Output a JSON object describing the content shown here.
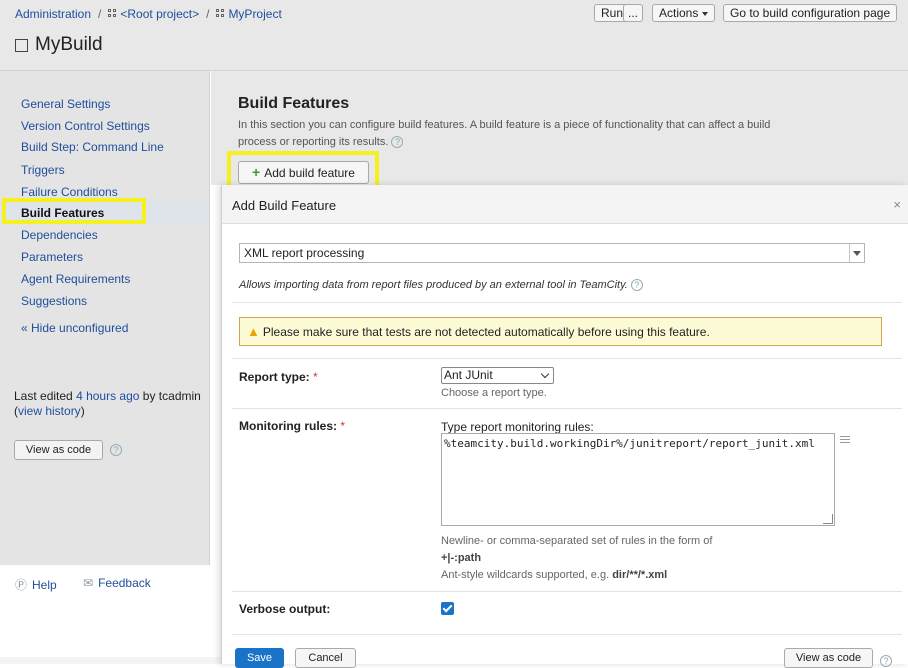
{
  "breadcrumb": {
    "items": [
      "Administration",
      "<Root project>",
      "MyProject"
    ]
  },
  "page_title": "MyBuild",
  "header_buttons": {
    "run": "Run",
    "more": "...",
    "actions": "Actions",
    "go_to_config": "Go to build configuration page"
  },
  "sidebar": {
    "items": [
      {
        "label": "General Settings"
      },
      {
        "label": "Version Control Settings"
      },
      {
        "label": "Build Step: Command Line"
      },
      {
        "label": "Triggers"
      },
      {
        "label": "Failure Conditions"
      },
      {
        "label": "Build Features"
      },
      {
        "label": "Dependencies"
      },
      {
        "label": "Parameters"
      },
      {
        "label": "Agent Requirements"
      },
      {
        "label": "Suggestions"
      }
    ],
    "hide_unconfigured": "« Hide unconfigured",
    "last_edited_prefix": "Last edited",
    "last_edited_time": "4 hours ago",
    "last_edited_by": "by tcadmin",
    "view_history": "view history",
    "view_as_code": "View as code"
  },
  "footer": {
    "help": "Help",
    "feedback": "Feedback"
  },
  "main": {
    "title": "Build Features",
    "description": "In this section you can configure build features. A build feature is a piece of functionality that can affect a build process or reporting its results.",
    "add_button": "Add build feature"
  },
  "dialog": {
    "title": "Add Build Feature",
    "close": "×",
    "feature_type": "XML report processing",
    "feature_description": "Allows importing data from report files produced by an external tool in TeamCity.",
    "warning": "Please make sure that tests are not detected automatically before using this feature.",
    "report_type_label": "Report type:",
    "report_type_value": "Ant JUnit",
    "report_type_hint": "Choose a report type.",
    "monitoring_rules_label": "Monitoring rules:",
    "monitoring_rules_prompt": "Type report monitoring rules:",
    "monitoring_rules_value": "%teamcity.build.workingDir%/junitreport/report_junit.xml",
    "rules_hint_1": "Newline- or comma-separated set of rules in the form of",
    "rules_hint_2": "+|-:path",
    "rules_hint_3": "Ant-style wildcards supported, e.g.",
    "rules_hint_example": "dir/**/*.xml",
    "verbose_label": "Verbose output:",
    "verbose_checked": true,
    "save": "Save",
    "cancel": "Cancel",
    "view_as_code": "View as code"
  },
  "colors": {
    "highlight": "#f5f01f",
    "primary": "#1a73c7",
    "link": "#1f4e9b"
  }
}
